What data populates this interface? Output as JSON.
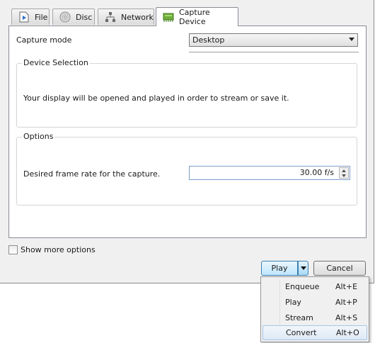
{
  "tabs": [
    {
      "label": "File",
      "icon": "file-play-icon",
      "active": false
    },
    {
      "label": "Disc",
      "icon": "disc-icon",
      "active": false
    },
    {
      "label": "Network",
      "icon": "network-icon",
      "active": false
    },
    {
      "label": "Capture Device",
      "icon": "capture-card-icon",
      "active": true
    }
  ],
  "capture": {
    "mode_label": "Capture mode",
    "mode_value": "Desktop"
  },
  "device_selection": {
    "title": "Device Selection",
    "message": "Your display will be opened and played in order to stream or save it."
  },
  "options": {
    "title": "Options",
    "frame_rate_label": "Desired frame rate for the capture.",
    "frame_rate_value": "30.00 f/s"
  },
  "show_more": {
    "label": "Show more options",
    "checked": false
  },
  "buttons": {
    "play": "Play",
    "cancel": "Cancel"
  },
  "play_menu": [
    {
      "label": "Enqueue",
      "shortcut": "Alt+E"
    },
    {
      "label": "Play",
      "shortcut": "Alt+P"
    },
    {
      "label": "Stream",
      "shortcut": "Alt+S"
    },
    {
      "label": "Convert",
      "shortcut": "Alt+O",
      "highlighted": true
    }
  ],
  "colors": {
    "accent": "#3c7fb1",
    "highlight": "#dfe9f5"
  }
}
